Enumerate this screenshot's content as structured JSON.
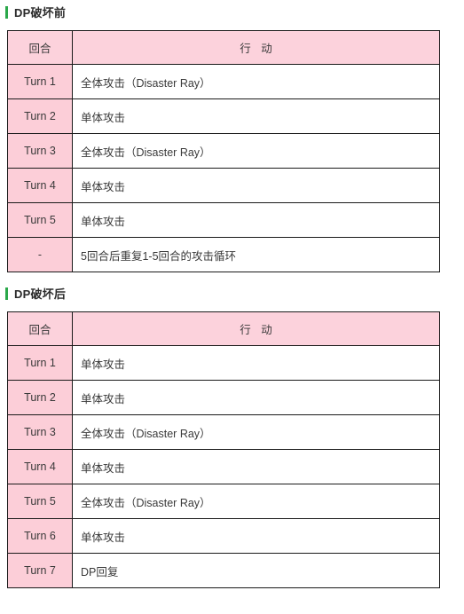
{
  "sections": [
    {
      "heading": "DP破坏前",
      "accent_color": "#2aa84a",
      "table": {
        "headers": [
          "回合",
          "行 动"
        ],
        "rows": [
          {
            "turn": "Turn 1",
            "action": "全体攻击（Disaster Ray）"
          },
          {
            "turn": "Turn 2",
            "action": "单体攻击"
          },
          {
            "turn": "Turn 3",
            "action": "全体攻击（Disaster Ray）"
          },
          {
            "turn": "Turn 4",
            "action": "单体攻击"
          },
          {
            "turn": "Turn 5",
            "action": "单体攻击"
          },
          {
            "turn": "-",
            "action": "5回合后重复1-5回合的攻击循环"
          }
        ]
      }
    },
    {
      "heading": "DP破坏后",
      "accent_color": "#2aa84a",
      "table": {
        "headers": [
          "回合",
          "行 动"
        ],
        "rows": [
          {
            "turn": "Turn 1",
            "action": "单体攻击"
          },
          {
            "turn": "Turn 2",
            "action": "单体攻击"
          },
          {
            "turn": "Turn 3",
            "action": "全体攻击（Disaster Ray）"
          },
          {
            "turn": "Turn 4",
            "action": "单体攻击"
          },
          {
            "turn": "Turn 5",
            "action": "全体攻击（Disaster Ray）"
          },
          {
            "turn": "Turn 6",
            "action": "单体攻击"
          },
          {
            "turn": "Turn 7",
            "action": "DP回复"
          }
        ]
      }
    }
  ],
  "colors": {
    "header_pink": "#fcd2dc",
    "cell_pink": "#fcced8",
    "border": "#1a1a1a",
    "accent_green": "#2aa84a",
    "text": "#3a3a3a"
  }
}
